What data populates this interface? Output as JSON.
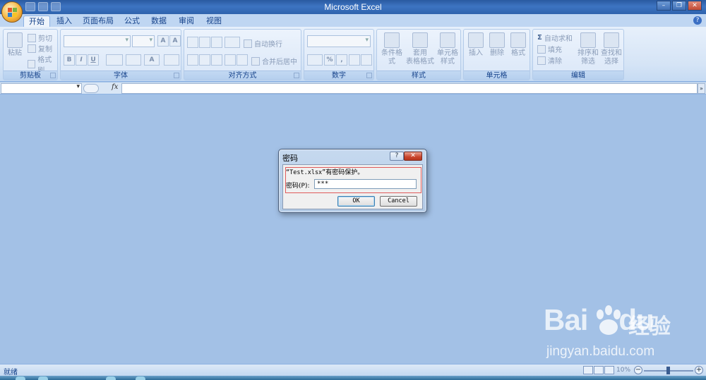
{
  "app": {
    "title": "Microsoft Excel"
  },
  "ribbon": {
    "tabs": [
      {
        "label": "开始",
        "active": true
      },
      {
        "label": "插入"
      },
      {
        "label": "页面布局"
      },
      {
        "label": "公式"
      },
      {
        "label": "数据"
      },
      {
        "label": "审阅"
      },
      {
        "label": "视图"
      }
    ],
    "clipboard": {
      "paste": "粘贴",
      "cut": "剪切",
      "copy": "复制",
      "format_painter": "格式刷",
      "label": "剪贴板"
    },
    "font": {
      "label": "字体",
      "bold": "B",
      "italic": "I",
      "underline": "U"
    },
    "alignment": {
      "wrap_text": "自动换行",
      "merge_center": "合并后居中",
      "label": "对齐方式"
    },
    "number": {
      "label": "数字",
      "percent": "%",
      "comma": ","
    },
    "styles": {
      "conditional": "条件格式",
      "table_format_1": "套用",
      "table_format_2": "表格格式",
      "cell_style_1": "单元格",
      "cell_style_2": "样式",
      "label": "样式"
    },
    "cells": {
      "insert": "插入",
      "delete": "删除",
      "format": "格式",
      "label": "单元格"
    },
    "editing": {
      "autosum": "自动求和",
      "fill": "填充",
      "clear": "清除",
      "sort_1": "排序和",
      "sort_2": "筛选",
      "find_1": "查找和",
      "find_2": "选择",
      "label": "编辑",
      "sigma": "Σ"
    }
  },
  "formula_bar": {
    "fx": "fx",
    "name_box": "",
    "formula": ""
  },
  "dialog": {
    "title": "密码",
    "help": "?",
    "close": "✕",
    "message_file": "“Test.xlsx”",
    "message_rest": "有密码保护。",
    "password_label": "密码(P):",
    "password_value": "***",
    "ok": "OK",
    "cancel": "Cancel"
  },
  "status": {
    "text": "就绪",
    "zoom": "10%"
  },
  "watermark": {
    "brand": "Bai",
    "brand_tail": "du",
    "cn": "经验",
    "url": "jingyan.baidu.com"
  }
}
